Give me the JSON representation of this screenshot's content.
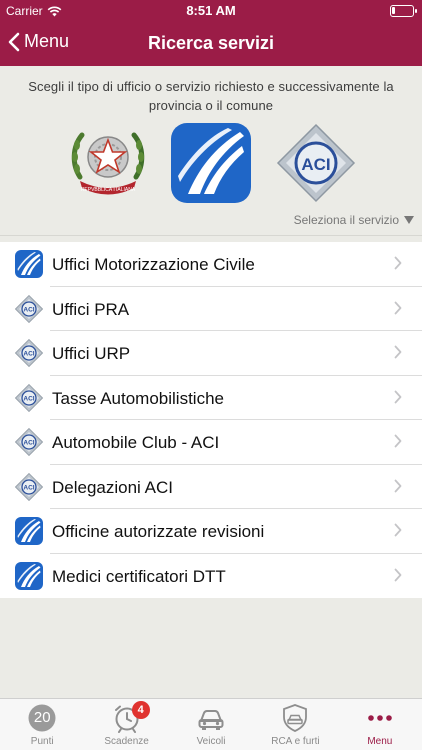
{
  "status_bar": {
    "carrier": "Carrier",
    "time": "8:51 AM",
    "battery_level": 0.15
  },
  "nav": {
    "back_label": "Menu",
    "title": "Ricerca servizi"
  },
  "intro": {
    "text": "Scegli il tipo di ufficio o servizio richiesto e successivamente la provincia o il comune",
    "logos": [
      {
        "name": "repubblica-italiana-emblem-icon"
      },
      {
        "name": "motorizzazione-logo-icon"
      },
      {
        "name": "aci-logo-icon"
      }
    ],
    "select_label": "Seleziona il servizio"
  },
  "services": [
    {
      "label": "Uffici Motorizzazione Civile",
      "icon": "motorizzazione-logo-icon"
    },
    {
      "label": "Uffici PRA",
      "icon": "aci-logo-icon"
    },
    {
      "label": "Uffici URP",
      "icon": "aci-logo-icon"
    },
    {
      "label": "Tasse Automobilistiche",
      "icon": "aci-logo-icon"
    },
    {
      "label": "Automobile Club - ACI",
      "icon": "aci-logo-icon"
    },
    {
      "label": "Delegazioni ACI",
      "icon": "aci-logo-icon"
    },
    {
      "label": "Officine autorizzate revisioni",
      "icon": "motorizzazione-logo-icon"
    },
    {
      "label": "Medici certificatori DTT",
      "icon": "motorizzazione-logo-icon"
    }
  ],
  "tabs": [
    {
      "label": "Punti",
      "icon": "points-circle-icon",
      "value": "20"
    },
    {
      "label": "Scadenze",
      "icon": "alarm-clock-icon",
      "badge": "4"
    },
    {
      "label": "Veicoli",
      "icon": "car-icon"
    },
    {
      "label": "RCA e furti",
      "icon": "shield-car-icon"
    },
    {
      "label": "Menu",
      "icon": "more-dots-icon",
      "active": true
    }
  ],
  "colors": {
    "brand": "#9b1c47",
    "background": "#ebebe6",
    "badge": "#e0332f",
    "moto_blue": "#1f66c7"
  }
}
